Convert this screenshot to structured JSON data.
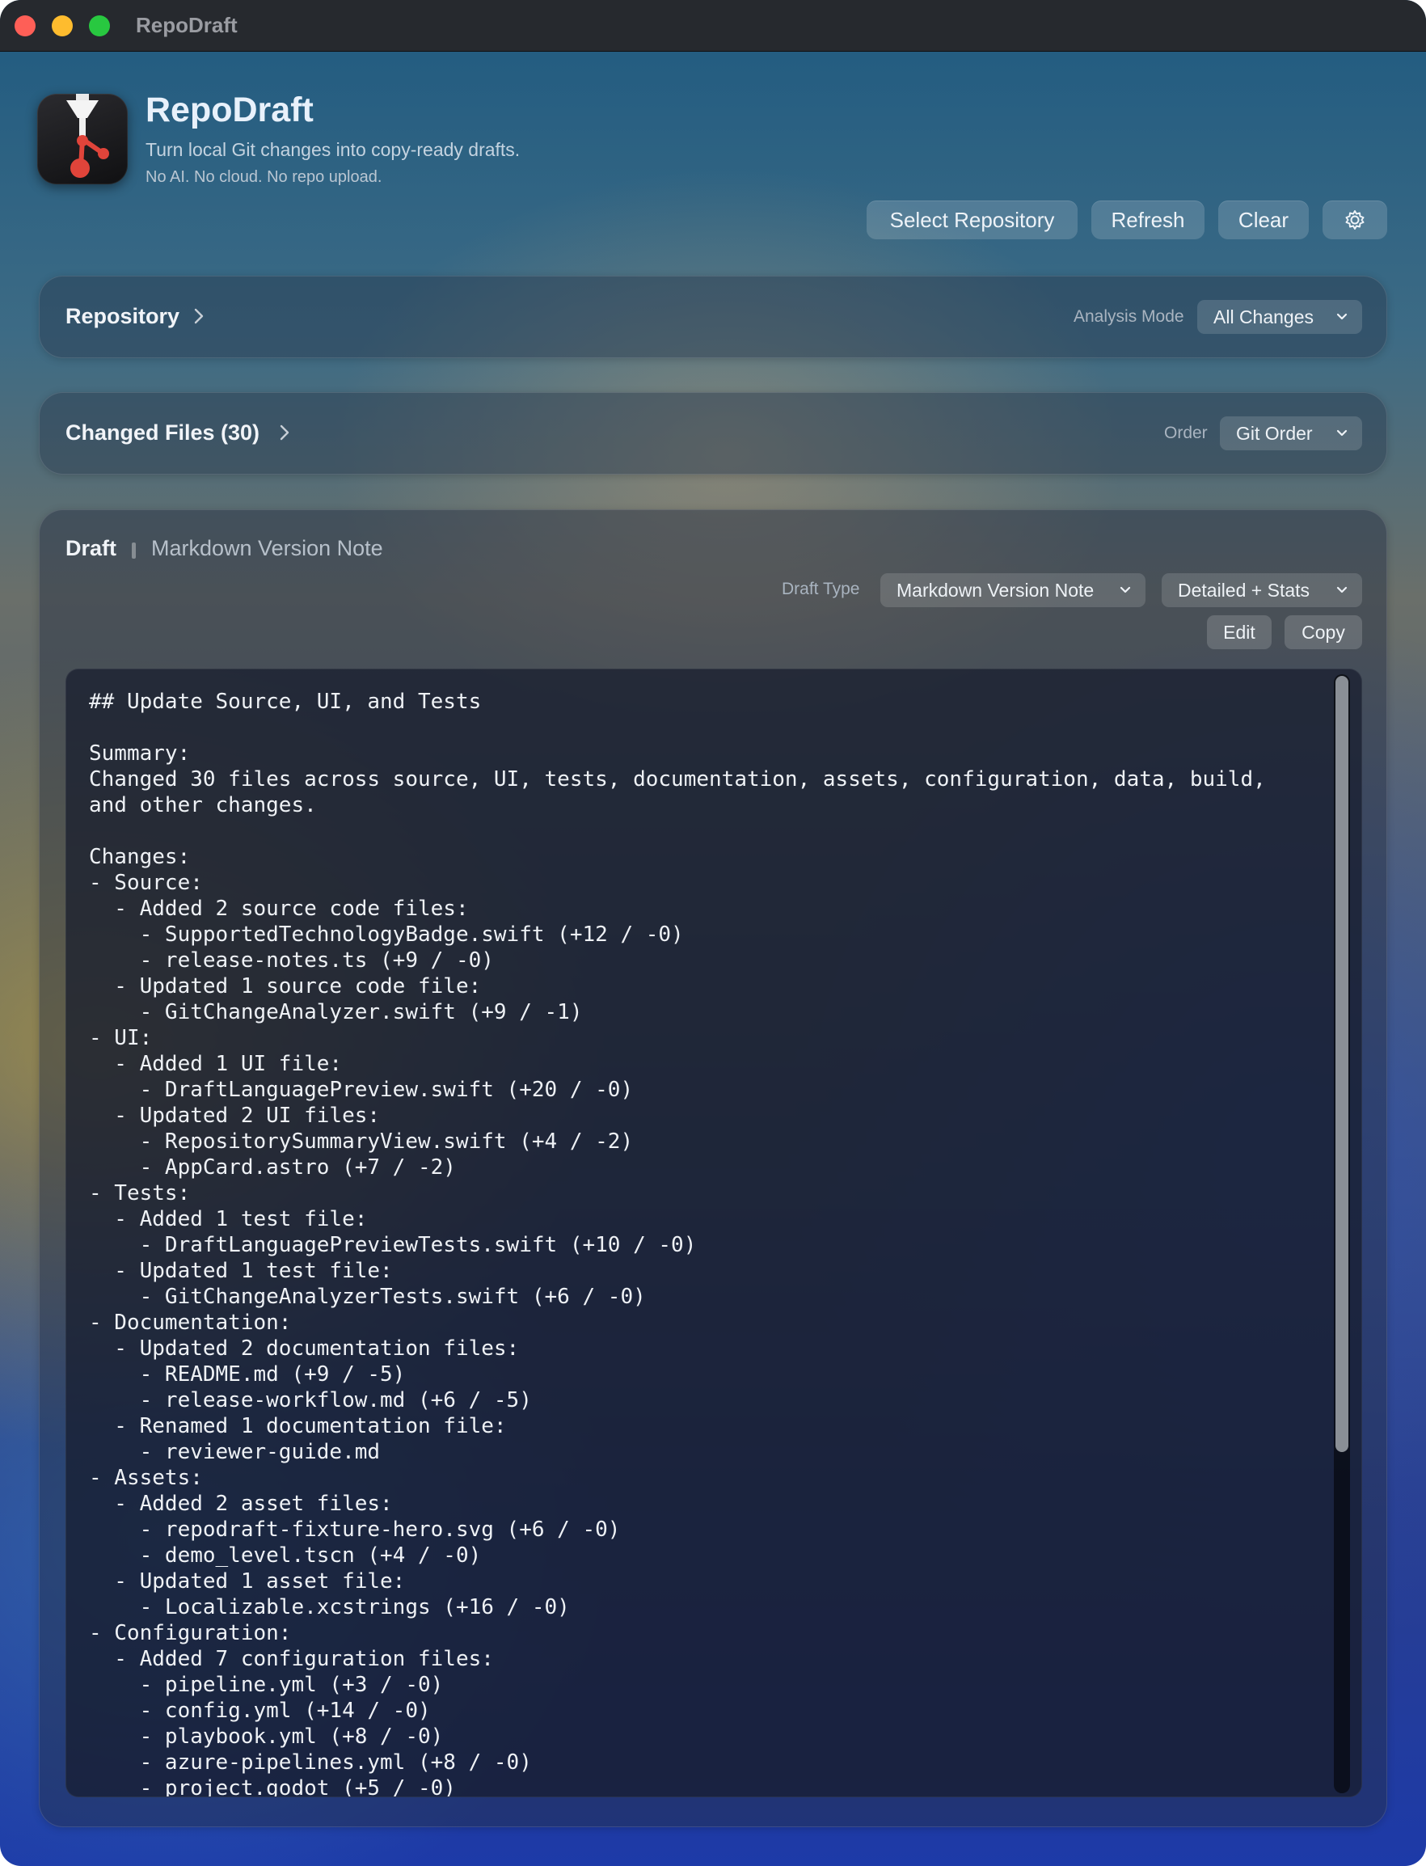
{
  "window": {
    "title": "RepoDraft"
  },
  "header": {
    "app_name": "RepoDraft",
    "tagline": "Turn local Git changes into copy-ready drafts.",
    "subtag": "No AI. No cloud. No repo upload."
  },
  "toolbar": {
    "select_repository": "Select Repository",
    "refresh": "Refresh",
    "clear": "Clear",
    "settings_icon": "gear-icon"
  },
  "repository_panel": {
    "title": "Repository",
    "analysis_mode_label": "Analysis Mode",
    "analysis_mode_value": "All Changes"
  },
  "files_panel": {
    "title": "Changed Files (30)",
    "order_label": "Order",
    "order_value": "Git Order"
  },
  "draft_panel": {
    "title": "Draft",
    "subtitle": "Markdown Version Note",
    "draft_type_label": "Draft Type",
    "draft_type_value": "Markdown Version Note",
    "detail_value": "Detailed + Stats",
    "edit_label": "Edit",
    "copy_label": "Copy",
    "content": "## Update Source, UI, and Tests\n\nSummary:\nChanged 30 files across source, UI, tests, documentation, assets, configuration, data, build,\nand other changes.\n\nChanges:\n- Source:\n  - Added 2 source code files:\n    - SupportedTechnologyBadge.swift (+12 / -0)\n    - release-notes.ts (+9 / -0)\n  - Updated 1 source code file:\n    - GitChangeAnalyzer.swift (+9 / -1)\n- UI:\n  - Added 1 UI file:\n    - DraftLanguagePreview.swift (+20 / -0)\n  - Updated 2 UI files:\n    - RepositorySummaryView.swift (+4 / -2)\n    - AppCard.astro (+7 / -2)\n- Tests:\n  - Added 1 test file:\n    - DraftLanguagePreviewTests.swift (+10 / -0)\n  - Updated 1 test file:\n    - GitChangeAnalyzerTests.swift (+6 / -0)\n- Documentation:\n  - Updated 2 documentation files:\n    - README.md (+9 / -5)\n    - release-workflow.md (+6 / -5)\n  - Renamed 1 documentation file:\n    - reviewer-guide.md\n- Assets:\n  - Added 2 asset files:\n    - repodraft-fixture-hero.svg (+6 / -0)\n    - demo_level.tscn (+4 / -0)\n  - Updated 1 asset file:\n    - Localizable.xcstrings (+16 / -0)\n- Configuration:\n  - Added 7 configuration files:\n    - pipeline.yml (+3 / -0)\n    - config.yml (+14 / -0)\n    - playbook.yml (+8 / -0)\n    - azure-pipelines.yml (+8 / -0)\n    - project.godot (+5 / -0)"
  }
}
